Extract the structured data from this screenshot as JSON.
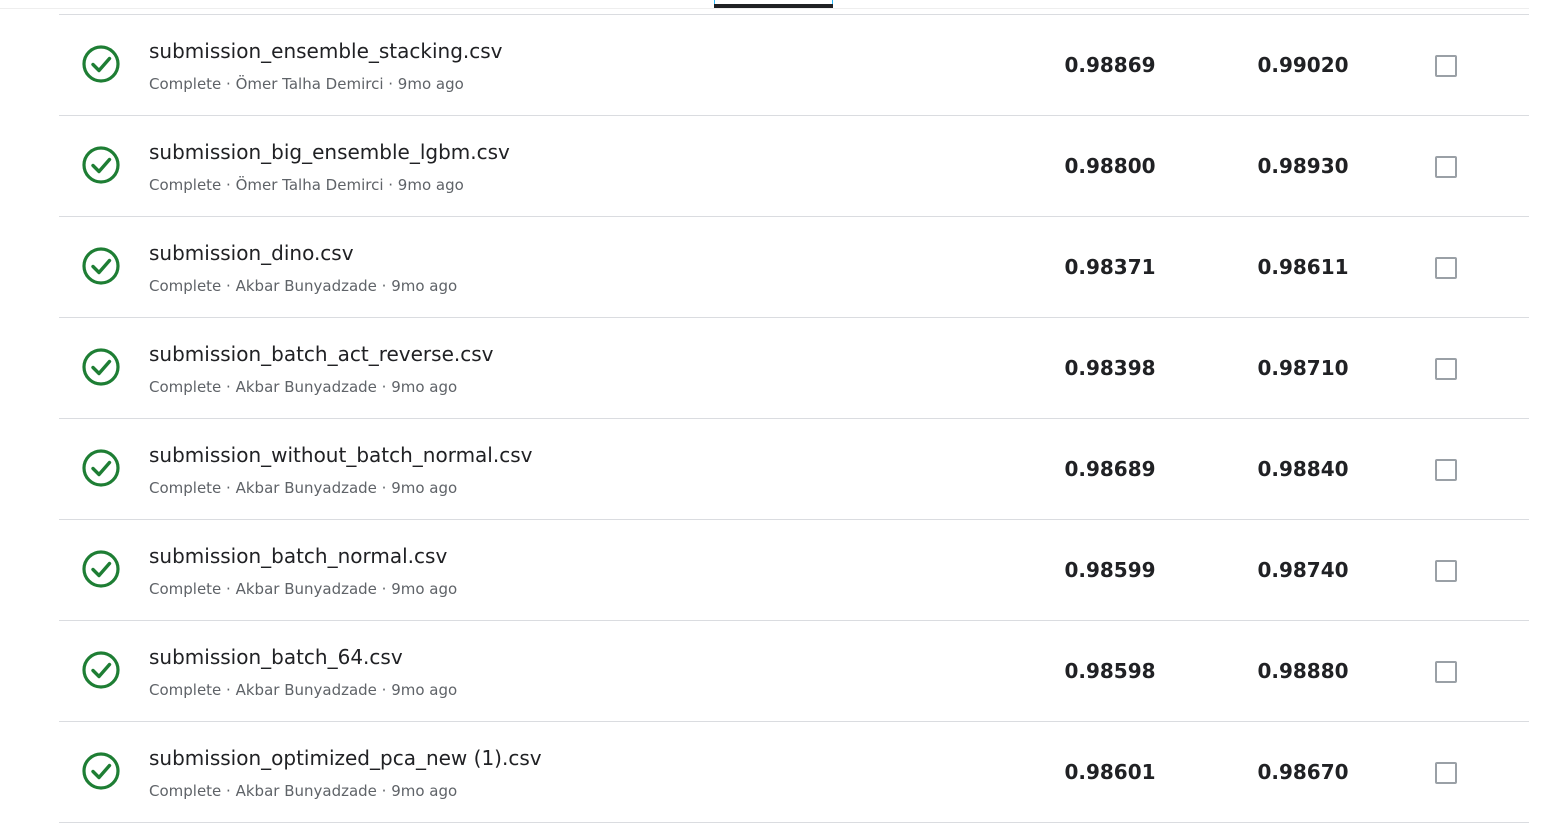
{
  "colors": {
    "success": "#1e7e34",
    "text_primary": "#202124",
    "text_secondary": "#5f6368",
    "divider": "#dadce0"
  },
  "submissions": [
    {
      "filename": "submission_ensemble_stacking.csv",
      "status": "Complete",
      "author": "Ömer Talha Demirci",
      "age": "9mo ago",
      "meta": "Complete · Ömer Talha Demirci · 9mo ago",
      "private_score": "0.98869",
      "public_score": "0.99020",
      "status_icon": "check-circle-icon",
      "selected": false
    },
    {
      "filename": "submission_big_ensemble_lgbm.csv",
      "status": "Complete",
      "author": "Ömer Talha Demirci",
      "age": "9mo ago",
      "meta": "Complete · Ömer Talha Demirci · 9mo ago",
      "private_score": "0.98800",
      "public_score": "0.98930",
      "status_icon": "check-circle-icon",
      "selected": false
    },
    {
      "filename": "submission_dino.csv",
      "status": "Complete",
      "author": "Akbar Bunyadzade",
      "age": "9mo ago",
      "meta": "Complete · Akbar Bunyadzade · 9mo ago",
      "private_score": "0.98371",
      "public_score": "0.98611",
      "status_icon": "check-circle-icon",
      "selected": false
    },
    {
      "filename": "submission_batch_act_reverse.csv",
      "status": "Complete",
      "author": "Akbar Bunyadzade",
      "age": "9mo ago",
      "meta": "Complete · Akbar Bunyadzade · 9mo ago",
      "private_score": "0.98398",
      "public_score": "0.98710",
      "status_icon": "check-circle-icon",
      "selected": false
    },
    {
      "filename": "submission_without_batch_normal.csv",
      "status": "Complete",
      "author": "Akbar Bunyadzade",
      "age": "9mo ago",
      "meta": "Complete · Akbar Bunyadzade · 9mo ago",
      "private_score": "0.98689",
      "public_score": "0.98840",
      "status_icon": "check-circle-icon",
      "selected": false
    },
    {
      "filename": "submission_batch_normal.csv",
      "status": "Complete",
      "author": "Akbar Bunyadzade",
      "age": "9mo ago",
      "meta": "Complete · Akbar Bunyadzade · 9mo ago",
      "private_score": "0.98599",
      "public_score": "0.98740",
      "status_icon": "check-circle-icon",
      "selected": false
    },
    {
      "filename": "submission_batch_64.csv",
      "status": "Complete",
      "author": "Akbar Bunyadzade",
      "age": "9mo ago",
      "meta": "Complete · Akbar Bunyadzade · 9mo ago",
      "private_score": "0.98598",
      "public_score": "0.98880",
      "status_icon": "check-circle-icon",
      "selected": false
    },
    {
      "filename": "submission_optimized_pca_new (1).csv",
      "status": "Complete",
      "author": "Akbar Bunyadzade",
      "age": "9mo ago",
      "meta": "Complete · Akbar Bunyadzade · 9mo ago",
      "private_score": "0.98601",
      "public_score": "0.98670",
      "status_icon": "check-circle-icon",
      "selected": false
    }
  ]
}
